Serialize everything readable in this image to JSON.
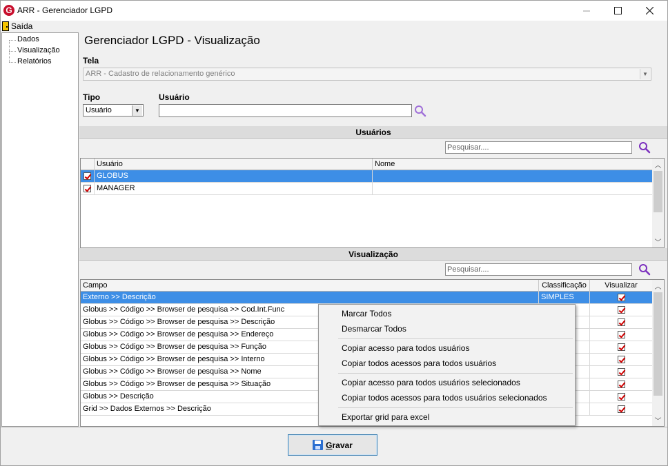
{
  "window": {
    "title": "ARR - Gerenciador LGPD",
    "logo_letter": "G"
  },
  "menu": {
    "saida_label": "Saída"
  },
  "tree": {
    "items": [
      "Dados",
      "Visualização",
      "Relatórios"
    ]
  },
  "page": {
    "title": "Gerenciador LGPD - Visualização"
  },
  "filters": {
    "tela_label": "Tela",
    "tela_value": "ARR - Cadastro de relacionamento genérico",
    "tipo_label": "Tipo",
    "tipo_value": "Usuário",
    "usuario_label": "Usuário",
    "usuario_value": ""
  },
  "usuarios_section": {
    "header": "Usuários",
    "search_placeholder": "Pesquisar....",
    "columns": [
      "Usuário",
      "Nome"
    ],
    "rows": [
      {
        "usuario": "GLOBUS",
        "nome": "",
        "checked": true,
        "selected": true
      },
      {
        "usuario": "MANAGER",
        "nome": "",
        "checked": true,
        "selected": false
      }
    ]
  },
  "visualizacao_section": {
    "header": "Visualização",
    "search_placeholder": "Pesquisar....",
    "columns": [
      "Campo",
      "Classificação",
      "Visualizar"
    ],
    "rows": [
      {
        "campo": "Externo >> Descrição",
        "classificacao": "SIMPLES",
        "visualizar": true,
        "selected": true
      },
      {
        "campo": "Globus >> Código >> Browser de pesquisa >> Cod.Int.Func",
        "classificacao": "",
        "visualizar": true,
        "selected": false
      },
      {
        "campo": "Globus >> Código >> Browser de pesquisa >> Descrição",
        "classificacao": "",
        "visualizar": true,
        "selected": false
      },
      {
        "campo": "Globus >> Código >> Browser de pesquisa >> Endereço",
        "classificacao": "",
        "visualizar": true,
        "selected": false
      },
      {
        "campo": "Globus >> Código >> Browser de pesquisa >> Função",
        "classificacao": "",
        "visualizar": true,
        "selected": false
      },
      {
        "campo": "Globus >> Código >> Browser de pesquisa >> Interno",
        "classificacao": "",
        "visualizar": true,
        "selected": false
      },
      {
        "campo": "Globus >> Código >> Browser de pesquisa >> Nome",
        "classificacao": "",
        "visualizar": true,
        "selected": false
      },
      {
        "campo": "Globus >> Código >> Browser de pesquisa >> Situação",
        "classificacao": "",
        "visualizar": true,
        "selected": false
      },
      {
        "campo": "Globus >> Descrição",
        "classificacao": "",
        "visualizar": true,
        "selected": false
      },
      {
        "campo": "Grid >> Dados Externos >>  Descrição",
        "classificacao": "",
        "visualizar": true,
        "selected": false
      }
    ]
  },
  "context_menu": {
    "groups": [
      [
        "Marcar Todos",
        "Desmarcar Todos"
      ],
      [
        "Copiar acesso para todos usuários",
        "Copiar todos acessos para todos usuários"
      ],
      [
        "Copiar acesso para todos usuários selecionados",
        "Copiar todos acessos para todos usuários selecionados"
      ],
      [
        "Exportar grid para excel"
      ]
    ]
  },
  "footer": {
    "save_label": "Gravar"
  },
  "colors": {
    "selection": "#3d8ee6",
    "search_icon": "#7b2fbe",
    "check": "#d00000",
    "logo": "#c8102e"
  }
}
